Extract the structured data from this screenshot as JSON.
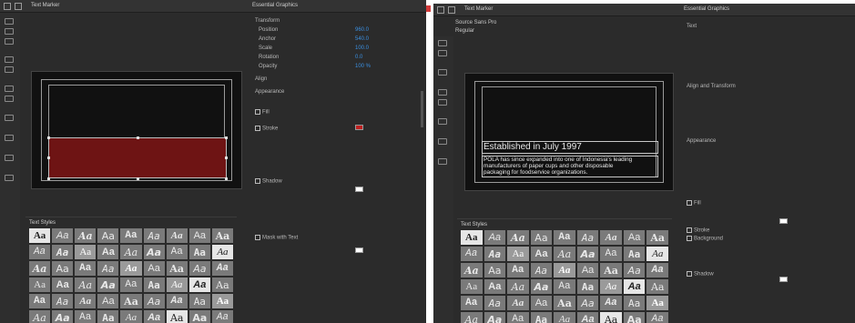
{
  "left": {
    "tab_title": "Text Marker",
    "essential_panel_title": "Essential Graphics",
    "essential_rows": [
      {
        "label": "Transform",
        "value": ""
      },
      {
        "label": "Position",
        "value": "960.0"
      },
      {
        "label": "Anchor",
        "value": "540.0"
      },
      {
        "label": "Scale",
        "value": "100.0"
      },
      {
        "label": "Rotation",
        "value": "0.0"
      },
      {
        "label": "Opacity",
        "value": "100 %"
      },
      {
        "label": "Align",
        "value": ""
      },
      {
        "label": "Appearance",
        "value": ""
      },
      {
        "label": "Fill",
        "value": ""
      },
      {
        "label": "Stroke",
        "value": ""
      },
      {
        "label": "Shadow",
        "value": ""
      }
    ],
    "mask_label": "Mask with Text",
    "styles_title": "Text Styles"
  },
  "right": {
    "tab_title": "Text Marker",
    "essential_panel_title": "Essential Graphics",
    "essential_rows": [
      {
        "label": "Text",
        "value": ""
      },
      {
        "label": "Align and Transform",
        "value": ""
      },
      {
        "label": "Appearance",
        "value": ""
      },
      {
        "label": "Fill",
        "value": ""
      },
      {
        "label": "Stroke",
        "value": ""
      },
      {
        "label": "Background",
        "value": ""
      },
      {
        "label": "Shadow",
        "value": ""
      }
    ],
    "font_label": "Source Sans Pro",
    "font_style": "Regular",
    "headline": "Established in July 1997",
    "body_lines": [
      "POLA has since expanded into one of Indonesia's leading",
      "manufacturers of paper cups and other disposable",
      "packaging for foodservice organizations."
    ],
    "styles_title": "Text Styles"
  },
  "style_sample": "Aa",
  "colors": {
    "accent": "#3a8fe0",
    "red_box": "#6e1414",
    "panel_bg": "#2b2b2b"
  }
}
